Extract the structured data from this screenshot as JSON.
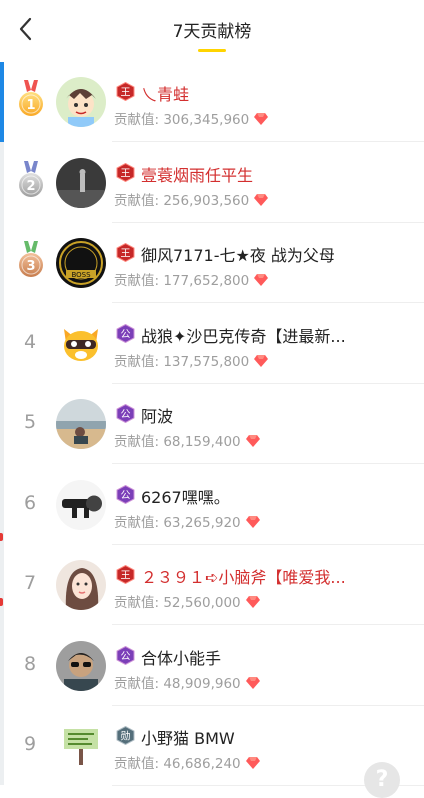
{
  "header": {
    "title": "7天贡献榜"
  },
  "contrib_prefix": "贡献值: ",
  "colors": {
    "accent": "#ffd400",
    "name_red": "#d32f2f",
    "gem": "#ff5a5a"
  },
  "rows": [
    {
      "rank": "1",
      "medal": "gold",
      "badge": "王",
      "badge_type": "king",
      "name": "乀青蛙",
      "name_color": "red",
      "value": "306,345,960",
      "avatar": "avatar-cartoon-boy"
    },
    {
      "rank": "2",
      "medal": "silver",
      "badge": "王",
      "badge_type": "king",
      "name": "壹蓑烟雨任平生",
      "name_color": "red",
      "value": "256,903,560",
      "avatar": "avatar-dark-photo"
    },
    {
      "rank": "3",
      "medal": "bronze",
      "badge": "王",
      "badge_type": "king",
      "name": "御风7171-七★夜 战为父母",
      "name_color": "dark",
      "value": "177,652,800",
      "avatar": "avatar-boss-logo"
    },
    {
      "rank": "4",
      "medal": "",
      "badge": "公",
      "badge_type": "duke",
      "name": "战狼✦沙巴克传奇【进最新...",
      "name_color": "dark",
      "value": "137,575,800",
      "avatar": "avatar-yy-bear"
    },
    {
      "rank": "5",
      "medal": "",
      "badge": "公",
      "badge_type": "duke",
      "name": "阿波",
      "name_color": "dark",
      "value": "68,159,400",
      "avatar": "avatar-beach-photo"
    },
    {
      "rank": "6",
      "medal": "",
      "badge": "公",
      "badge_type": "duke",
      "name": "6267嘿嘿。",
      "name_color": "dark",
      "value": "63,265,920",
      "avatar": "avatar-scope"
    },
    {
      "rank": "7",
      "medal": "",
      "badge": "王",
      "badge_type": "king",
      "name": "２３９１➪小脑斧【唯爱我...",
      "name_color": "red",
      "value": "52,560,000",
      "avatar": "avatar-girl"
    },
    {
      "rank": "8",
      "medal": "",
      "badge": "公",
      "badge_type": "duke",
      "name": "合体小能手",
      "name_color": "dark",
      "value": "48,909,960",
      "avatar": "avatar-man-glasses"
    },
    {
      "rank": "9",
      "medal": "",
      "badge": "勋",
      "badge_type": "merit",
      "name": "小野猫  BMW",
      "name_color": "dark",
      "value": "46,686,240",
      "avatar": "avatar-sign"
    }
  ],
  "help_label": "?"
}
